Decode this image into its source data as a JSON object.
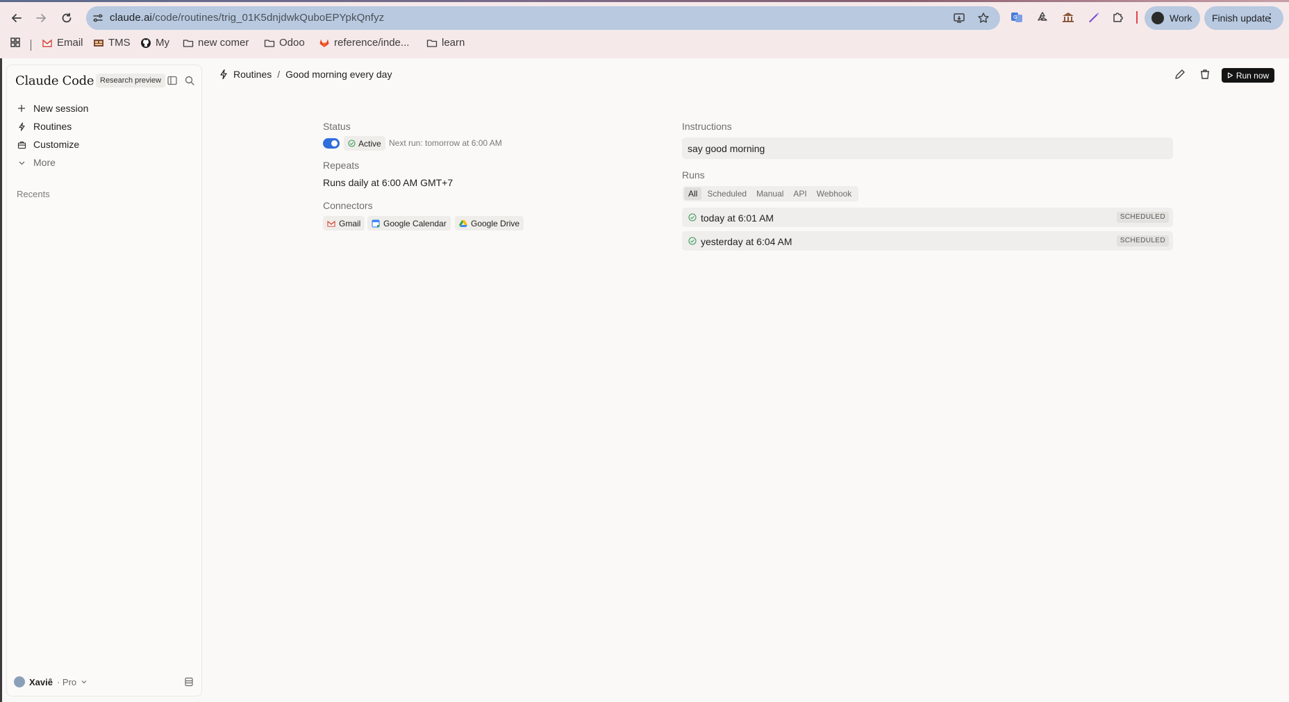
{
  "browser": {
    "url_host": "claude.ai",
    "url_path": "/code/routines/trig_01K5dnjdwkQuboEPYpkQnfyz",
    "profile_label": "Work",
    "update_label": "Finish update",
    "bookmarks": [
      {
        "label": "Email",
        "icon": "gmail-icon"
      },
      {
        "label": "TMS",
        "icon": "tms-icon"
      },
      {
        "label": "My",
        "icon": "github-icon"
      },
      {
        "label": "new comer",
        "icon": "folder-icon"
      },
      {
        "label": "Odoo",
        "icon": "folder-icon"
      },
      {
        "label": "reference/inde...",
        "icon": "gitlab-icon"
      },
      {
        "label": "learn",
        "icon": "folder-icon"
      }
    ]
  },
  "sidebar": {
    "brand": "Claude Code",
    "badge": "Research preview",
    "nav": [
      {
        "label": "New session",
        "icon": "plus-icon"
      },
      {
        "label": "Routines",
        "icon": "routine-icon"
      },
      {
        "label": "Customize",
        "icon": "briefcase-icon"
      },
      {
        "label": "More",
        "icon": "chevron-down-icon"
      }
    ],
    "recents_label": "Recents",
    "user": {
      "name": "Xaviê",
      "tier": "· Pro"
    }
  },
  "header": {
    "crumb_root": "Routines",
    "crumb_sep": "/",
    "crumb_current": "Good morning every day",
    "run_now_label": "Run now"
  },
  "detail": {
    "status_label": "Status",
    "status_value": "Active",
    "toggle_on": true,
    "next_run": "Next run: tomorrow at 6:00 AM",
    "repeats_label": "Repeats",
    "repeats_value": "Runs daily at 6:00 AM GMT+7",
    "connectors_label": "Connectors",
    "connectors": [
      {
        "label": "Gmail",
        "icon": "gmail-icon"
      },
      {
        "label": "Google Calendar",
        "icon": "google-calendar-icon"
      },
      {
        "label": "Google Drive",
        "icon": "google-drive-icon"
      }
    ],
    "instructions_label": "Instructions",
    "instructions_value": "say good morning",
    "runs_label": "Runs",
    "run_tabs": [
      "All",
      "Scheduled",
      "Manual",
      "API",
      "Webhook"
    ],
    "selected_tab": "All",
    "runs": [
      {
        "when": "today at 6:01 AM",
        "kind": "SCHEDULED",
        "status": "success"
      },
      {
        "when": "yesterday at 6:04 AM",
        "kind": "SCHEDULED",
        "status": "success"
      }
    ]
  },
  "colors": {
    "accent_blue": "#2f6fdb",
    "success_green": "#3a9a5a",
    "run_button_bg": "#141414"
  }
}
